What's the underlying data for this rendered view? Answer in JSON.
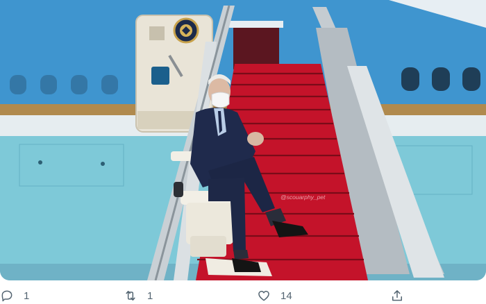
{
  "photo": {
    "watermark": "@scouarphy_pet",
    "icons": [
      "presidential-seal-icon"
    ],
    "colors": {
      "sky": "#cfe3f1",
      "fuselage_blue": "#3f95cf",
      "fuselage_teal": "#7ec9d8",
      "gold_stripe": "#b08a4e",
      "carpet_red": "#c4132a",
      "suit_navy": "#1f2a4c"
    }
  },
  "actions": {
    "reply": {
      "icon": "reply-icon",
      "count": "1"
    },
    "retweet": {
      "icon": "retweet-icon",
      "count": "1"
    },
    "like": {
      "icon": "heart-icon",
      "count": "14"
    },
    "share": {
      "icon": "share-icon"
    }
  }
}
